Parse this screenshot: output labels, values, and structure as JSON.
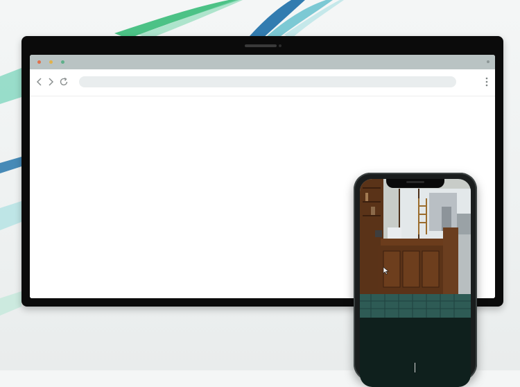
{
  "browser": {
    "window_controls": [
      "close",
      "minimize",
      "maximize"
    ],
    "nav": {
      "back_icon": "chevron-left-icon",
      "forward_icon": "chevron-right-icon",
      "reload_icon": "reload-icon",
      "menu_icon": "more-vertical-icon"
    },
    "address_bar": {
      "value": "",
      "placeholder": ""
    }
  },
  "phone": {
    "content": "cafe-interior-photo"
  },
  "colors": {
    "accent_green": "#1aa874",
    "accent_blue": "#1d6fa8",
    "phone_dark": "#0f201d",
    "dot_red": "#e0704a",
    "dot_yellow": "#e2b24a",
    "dot_green": "#5fb08a"
  }
}
